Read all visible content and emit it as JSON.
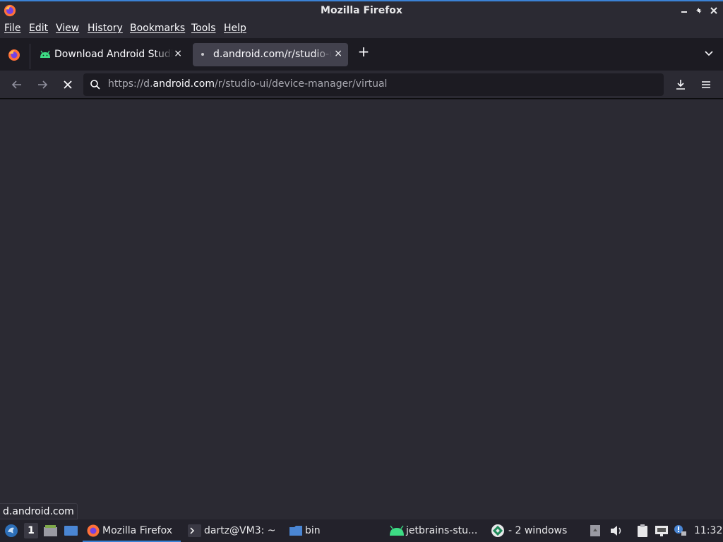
{
  "window": {
    "title": "Mozilla Firefox",
    "minimize_icon": "minimize-icon",
    "maximize_icon": "restore-icon",
    "close_icon": "close-icon"
  },
  "menu": {
    "items": [
      "File",
      "Edit",
      "View",
      "History",
      "Bookmarks",
      "Tools",
      "Help"
    ]
  },
  "tabs": [
    {
      "label": "Download Android Studio",
      "icon": "android-icon",
      "active": false,
      "close": "×"
    },
    {
      "label": "d.android.com/r/studio-ui",
      "icon": "loading-dot",
      "active": true,
      "close": "×"
    }
  ],
  "toolbar": {
    "new_tab_label": "+",
    "url_prefix": "https://d.",
    "url_host": "android.com",
    "url_path": "/r/studio-ui/device-manager/virtual",
    "stop_label": "✕"
  },
  "status": {
    "text": "d.android.com"
  },
  "taskbar": {
    "workspace": "1",
    "items": [
      {
        "label": "Mozilla Firefox",
        "icon": "firefox-icon",
        "active": true
      },
      {
        "label": "dartz@VM3: ~",
        "icon": "terminal-icon",
        "active": false
      },
      {
        "label": "bin",
        "icon": "folder-icon",
        "active": false
      },
      {
        "label": "jetbrains-stu...",
        "icon": "android-icon",
        "active": false
      },
      {
        "label": "- 2 windows",
        "icon": "app-group-icon",
        "active": false
      }
    ],
    "clock": "11:32"
  },
  "colors": {
    "accent": "#3b82d6",
    "background": "#2b2a33",
    "android_green": "#3ddc84"
  }
}
